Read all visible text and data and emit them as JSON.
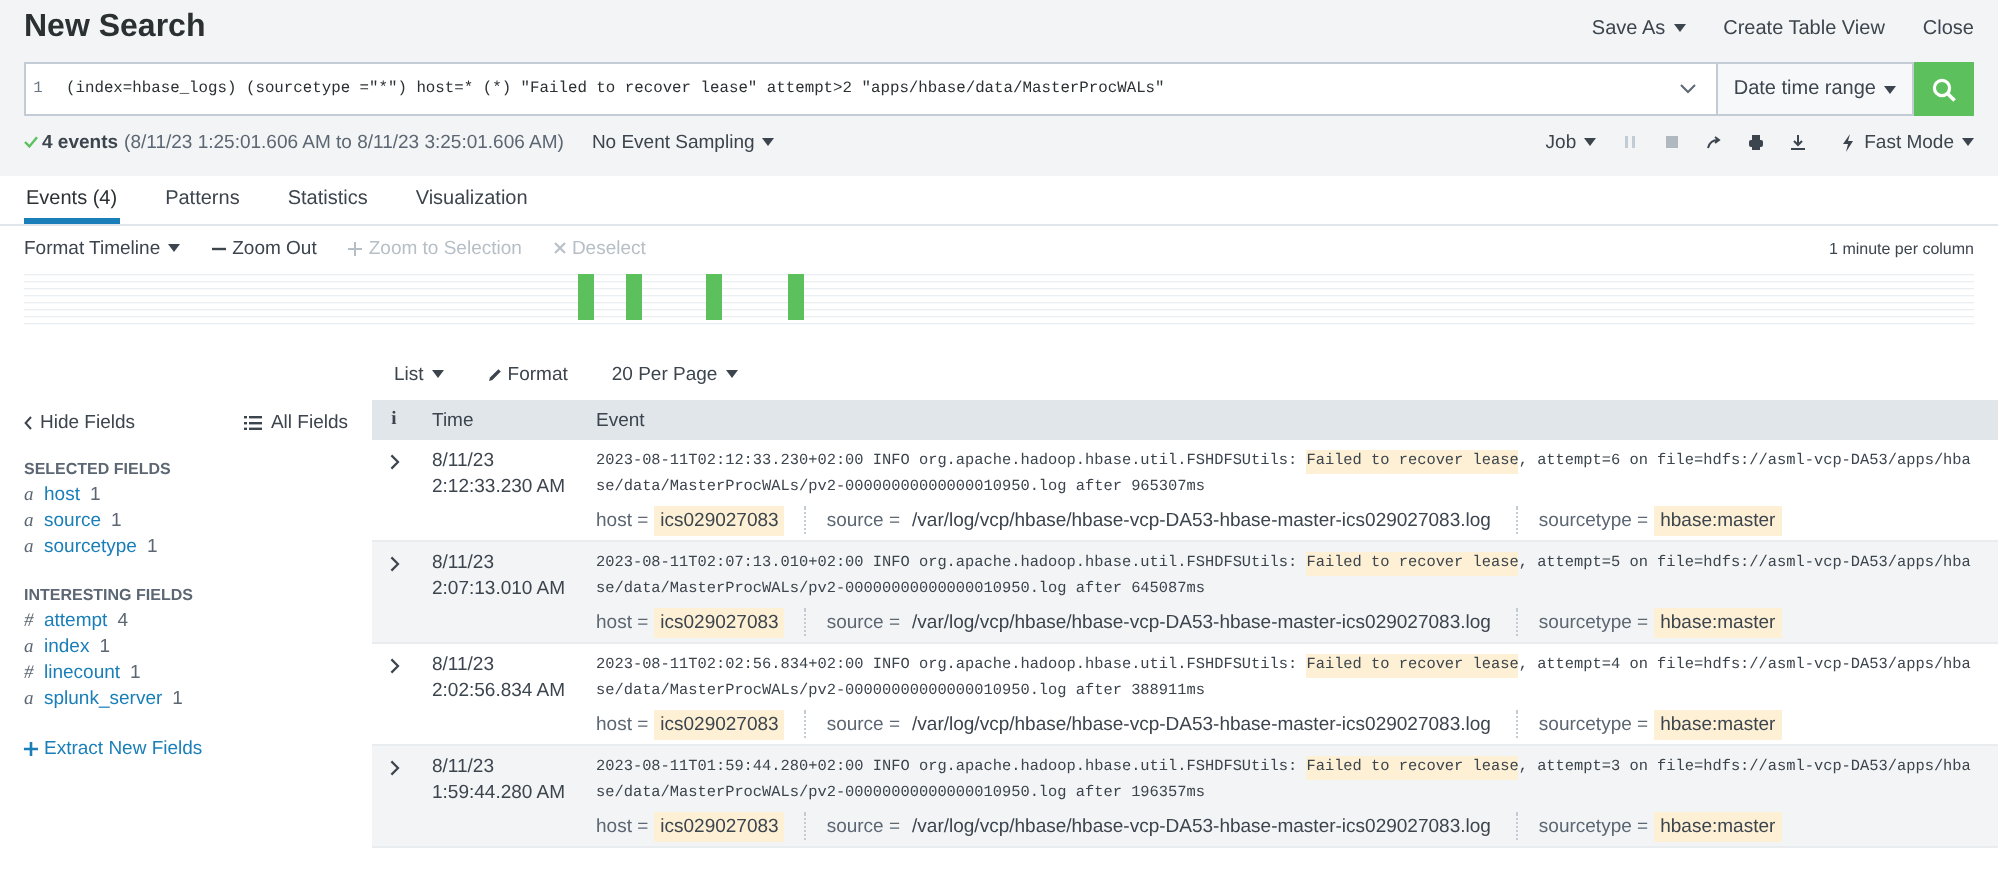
{
  "header": {
    "title": "New Search",
    "actions": [
      {
        "label": "Save As",
        "dropdown": true
      },
      {
        "label": "Create Table View",
        "dropdown": false
      },
      {
        "label": "Close",
        "dropdown": false
      }
    ]
  },
  "search": {
    "line_number": "1",
    "query": "(index=hbase_logs) (sourcetype =\"*\") host=* (*) \"Failed to recover lease\" attempt>2 \"apps/hbase/data/MasterProcWALs\"",
    "time_range": "Date time range"
  },
  "status": {
    "count": "4 events",
    "range": "(8/11/23 1:25:01.606 AM to 8/11/23 3:25:01.606 AM)",
    "sampling": "No Event Sampling",
    "job": "Job",
    "mode": "Fast Mode"
  },
  "tabs": [
    {
      "label": "Events (4)",
      "selected": true
    },
    {
      "label": "Patterns",
      "selected": false
    },
    {
      "label": "Statistics",
      "selected": false
    },
    {
      "label": "Visualization",
      "selected": false
    }
  ],
  "timeline_toolbar": [
    {
      "kind": "menu",
      "label": "Format Timeline",
      "disabled": false
    },
    {
      "kind": "zoom-out",
      "label": "Zoom Out",
      "disabled": false
    },
    {
      "kind": "zoom-in",
      "label": "Zoom to Selection",
      "disabled": true
    },
    {
      "kind": "deselect",
      "label": "Deselect",
      "disabled": true
    }
  ],
  "scale": "1 minute per column",
  "results_toolbar": [
    {
      "kind": "menu",
      "label": "List"
    },
    {
      "kind": "format",
      "label": "Format"
    },
    {
      "kind": "menu",
      "label": "20 Per Page"
    }
  ],
  "fields": {
    "hide": "Hide Fields",
    "all": "All Fields",
    "groups": [
      {
        "title": "SELECTED FIELDS",
        "items": [
          {
            "type": "a",
            "name": "host",
            "count": "1"
          },
          {
            "type": "a",
            "name": "source",
            "count": "1"
          },
          {
            "type": "a",
            "name": "sourcetype",
            "count": "1"
          }
        ]
      },
      {
        "title": "INTERESTING FIELDS",
        "items": [
          {
            "type": "#",
            "name": "attempt",
            "count": "4"
          },
          {
            "type": "a",
            "name": "index",
            "count": "1"
          },
          {
            "type": "#",
            "name": "linecount",
            "count": "1"
          },
          {
            "type": "a",
            "name": "splunk_server",
            "count": "1"
          }
        ]
      }
    ],
    "extract": "Extract New Fields"
  },
  "table": {
    "columns": [
      "i",
      "Time",
      "Event"
    ],
    "rows": [
      {
        "date": "8/11/23",
        "time": "2:12:33.230 AM",
        "pre": "2023-08-11T02:12:33.230+02:00 INFO org.apache.hadoop.hbase.util.FSHDFSUtils: ",
        "match": "Failed to recover lease",
        "post": ", attempt=6 on file=hdfs://asml-vcp-DA53/apps/hbase/data/MasterProcWALs/pv2-00000000000000010950.log after 965307ms",
        "fields": [
          {
            "key": "host =",
            "value": "ics029027083",
            "highlighted": true
          },
          {
            "key": "source =",
            "value": "/var/log/vcp/hbase/hbase-vcp-DA53-hbase-master-ics029027083.log",
            "highlighted": false
          },
          {
            "key": "sourcetype =",
            "value": "hbase:master",
            "highlighted": true
          }
        ]
      },
      {
        "date": "8/11/23",
        "time": "2:07:13.010 AM",
        "pre": "2023-08-11T02:07:13.010+02:00 INFO org.apache.hadoop.hbase.util.FSHDFSUtils: ",
        "match": "Failed to recover lease",
        "post": ", attempt=5 on file=hdfs://asml-vcp-DA53/apps/hbase/data/MasterProcWALs/pv2-00000000000000010950.log after 645087ms",
        "fields": [
          {
            "key": "host =",
            "value": "ics029027083",
            "highlighted": true
          },
          {
            "key": "source =",
            "value": "/var/log/vcp/hbase/hbase-vcp-DA53-hbase-master-ics029027083.log",
            "highlighted": false
          },
          {
            "key": "sourcetype =",
            "value": "hbase:master",
            "highlighted": true
          }
        ]
      },
      {
        "date": "8/11/23",
        "time": "2:02:56.834 AM",
        "pre": "2023-08-11T02:02:56.834+02:00 INFO org.apache.hadoop.hbase.util.FSHDFSUtils: ",
        "match": "Failed to recover lease",
        "post": ", attempt=4 on file=hdfs://asml-vcp-DA53/apps/hbase/data/MasterProcWALs/pv2-00000000000000010950.log after 388911ms",
        "fields": [
          {
            "key": "host =",
            "value": "ics029027083",
            "highlighted": true
          },
          {
            "key": "source =",
            "value": "/var/log/vcp/hbase/hbase-vcp-DA53-hbase-master-ics029027083.log",
            "highlighted": false
          },
          {
            "key": "sourcetype =",
            "value": "hbase:master",
            "highlighted": true
          }
        ]
      },
      {
        "date": "8/11/23",
        "time": "1:59:44.280 AM",
        "pre": "2023-08-11T01:59:44.280+02:00 INFO org.apache.hadoop.hbase.util.FSHDFSUtils: ",
        "match": "Failed to recover lease",
        "post": ", attempt=3 on file=hdfs://asml-vcp-DA53/apps/hbase/data/MasterProcWALs/pv2-00000000000000010950.log after 196357ms",
        "fields": [
          {
            "key": "host =",
            "value": "ics029027083",
            "highlighted": true
          },
          {
            "key": "source =",
            "value": "/var/log/vcp/hbase/hbase-vcp-DA53-hbase-master-ics029027083.log",
            "highlighted": false
          },
          {
            "key": "sourcetype =",
            "value": "hbase:master",
            "highlighted": true
          }
        ]
      }
    ]
  }
}
